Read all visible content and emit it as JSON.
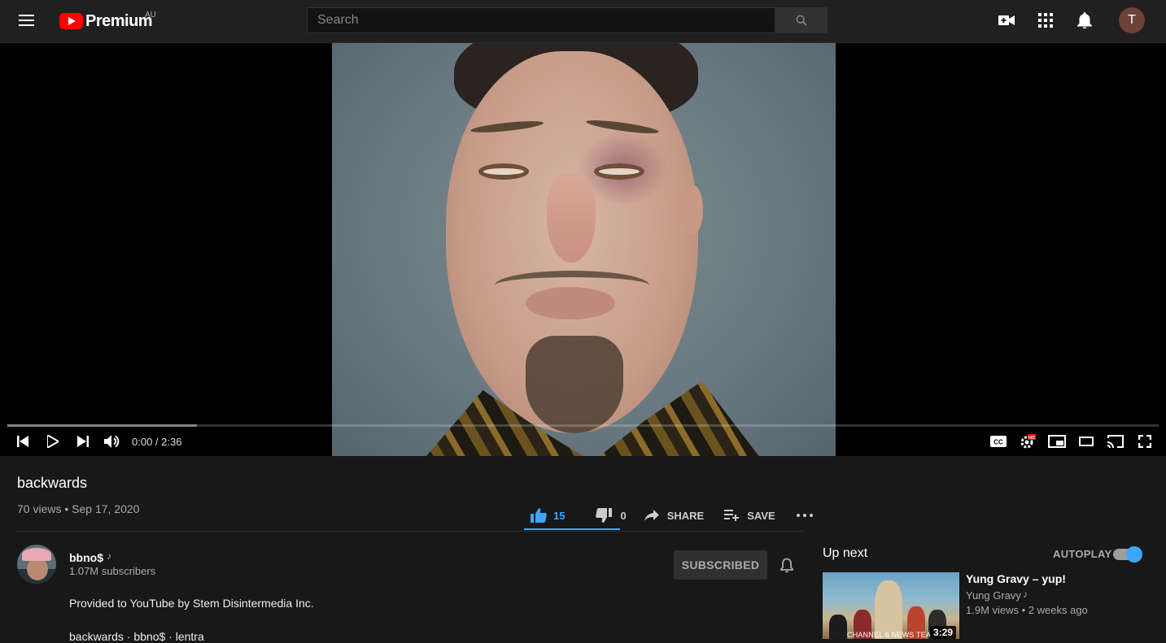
{
  "header": {
    "logo_text": "Premium",
    "region": "AU",
    "search_placeholder": "Search"
  },
  "player": {
    "current_time": "0:00",
    "duration": "2:36",
    "time_display": "0:00 / 2:36",
    "progress_fraction": 0,
    "buffer_fraction": 0.165,
    "settings_badge": "HD"
  },
  "video": {
    "title": "backwards",
    "views": "70 views",
    "date": "Sep 17, 2020",
    "likes": "15",
    "dislikes": "0",
    "share_label": "SHARE",
    "save_label": "SAVE"
  },
  "channel": {
    "name": "bbno$",
    "subscribers": "1.07M subscribers",
    "subscribe_label": "SUBSCRIBED"
  },
  "description": {
    "line1": "Provided to YouTube by Stem Disintermedia Inc.",
    "line2": "backwards · bbno$ · lentra"
  },
  "sidebar": {
    "up_next": "Up next",
    "autoplay": "AUTOPLAY",
    "recommendations": [
      {
        "title": "Yung Gravy – yup!",
        "channel": "Yung Gravy",
        "meta": "1.9M views • 2 weeks ago",
        "duration": "3:29",
        "thumb_text": "CHANNEL 6 NEWS TEA"
      }
    ]
  },
  "colors": {
    "accent_blue": "#3ea6ff",
    "youtube_red": "#ff0000",
    "background": "#181818",
    "topbar": "#202020"
  },
  "icons": {
    "menu": "hamburger-icon",
    "search": "search-icon",
    "create": "video-camera-plus-icon",
    "apps": "grid-icon",
    "notifications": "bell-icon",
    "music_note": "music-note-icon"
  }
}
